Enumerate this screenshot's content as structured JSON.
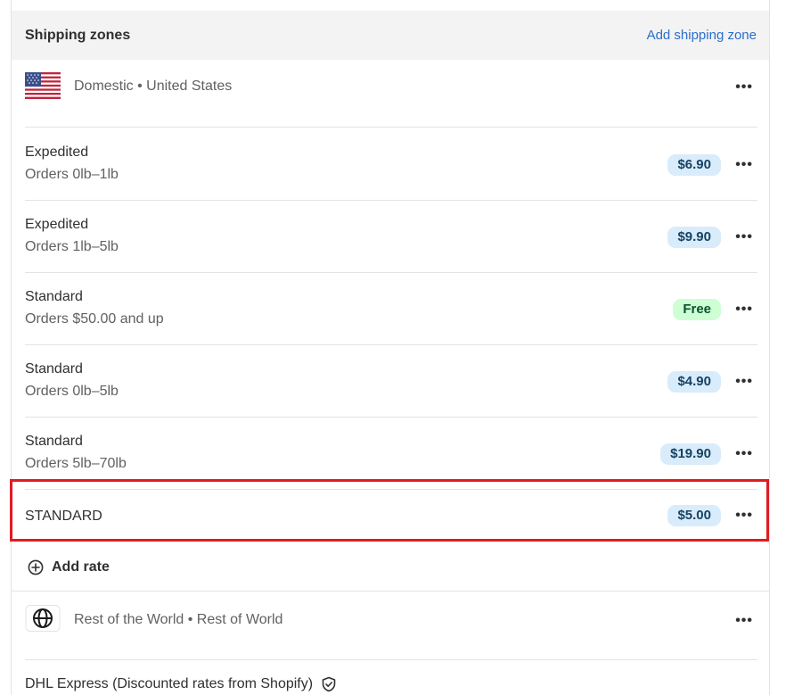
{
  "header": {
    "title": "Shipping zones",
    "action_label": "Add shipping zone"
  },
  "domestic_zone": {
    "icon": "us-flag-icon",
    "label": "Domestic • United States",
    "rates": [
      {
        "name": "Expedited",
        "condition": "Orders 0lb–1lb",
        "price": "$6.90",
        "free": false
      },
      {
        "name": "Expedited",
        "condition": "Orders 1lb–5lb",
        "price": "$9.90",
        "free": false
      },
      {
        "name": "Standard",
        "condition": "Orders $50.00 and up",
        "price": "Free",
        "free": true
      },
      {
        "name": "Standard",
        "condition": "Orders 0lb–5lb",
        "price": "$4.90",
        "free": false
      },
      {
        "name": "Standard",
        "condition": "Orders 5lb–70lb",
        "price": "$19.90",
        "free": false
      }
    ],
    "highlighted_rate": {
      "name": "STANDARD",
      "price": "$5.00"
    },
    "add_rate_label": "Add rate"
  },
  "world_zone": {
    "icon": "globe-icon",
    "label": "Rest of the World • Rest of World"
  },
  "carrier": {
    "label": "DHL Express (Discounted rates from Shopify)",
    "icon": "shield-check-icon"
  },
  "colors": {
    "link": "#2c6ecb",
    "badge_bg": "#d9ecfb",
    "badge_free_bg": "#cdfed4",
    "highlight_border": "#e11b22"
  }
}
